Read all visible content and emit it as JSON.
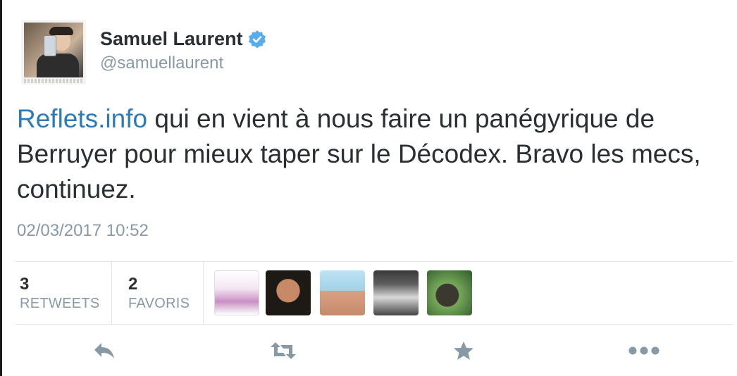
{
  "user": {
    "display_name": "Samuel Laurent",
    "handle": "@samuellaurent",
    "verified": true
  },
  "tweet": {
    "link_text": "Reflets.info",
    "body_text": " qui en vient à nous faire un panégyrique de Berruyer pour mieux taper sur le Décodex. Bravo les mecs, continuez.",
    "timestamp": "02/03/2017 10:52"
  },
  "stats": {
    "retweets_count": "3",
    "retweets_label": "RETWEETS",
    "favorites_count": "2",
    "favorites_label": "FAVORIS"
  },
  "favoriters": [
    {
      "icon": "cartoon-avatar"
    },
    {
      "icon": "laughing-man-avatar"
    },
    {
      "icon": "beach-man-avatar"
    },
    {
      "icon": "reading-man-avatar"
    },
    {
      "icon": "monkey-avatar"
    }
  ],
  "actions": [
    "reply-icon",
    "retweet-icon",
    "favorite-star-icon",
    "more-dots-icon"
  ],
  "colors": {
    "link": "#2b7bb9",
    "verified": "#55acee",
    "muted": "#8899a6",
    "action_icon": "#8899a6",
    "text": "#292f33"
  }
}
